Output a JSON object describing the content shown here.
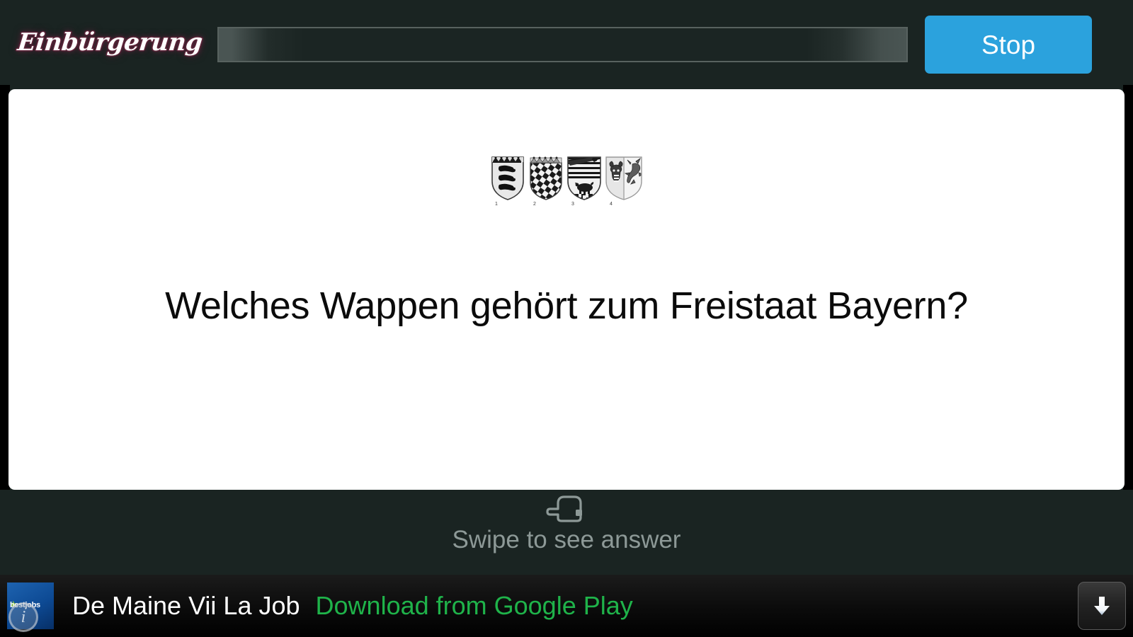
{
  "header": {
    "brand": "Einbürgerung",
    "search": {
      "value": "",
      "placeholder": ""
    },
    "stop_label": "Stop"
  },
  "card": {
    "question": "Welches Wappen gehört zum Freistaat Bayern?",
    "coats_of_arms": [
      {
        "number": "1",
        "name": "baden-wuerttemberg-coat-of-arms"
      },
      {
        "number": "2",
        "name": "bayern-coat-of-arms"
      },
      {
        "number": "3",
        "name": "sachsen-anhalt-coat-of-arms"
      },
      {
        "number": "4",
        "name": "mecklenburg-vorpommern-coat-of-arms"
      }
    ]
  },
  "swipe": {
    "label": "Swipe to see answer",
    "icon": "pointing-hand-left-icon"
  },
  "ad": {
    "icon_label": "bestjobs",
    "info_glyph": "i",
    "title": "De Maine Vii La Job",
    "cta": "Download from Google Play",
    "download_icon": "download-arrow-icon"
  },
  "colors": {
    "background": "#1a2422",
    "accent_blue": "#2ba2dd",
    "card": "#ffffff",
    "ad_green": "#1fb34a",
    "brand_outline": "#5c2338",
    "swipe_text": "#8d9997"
  }
}
